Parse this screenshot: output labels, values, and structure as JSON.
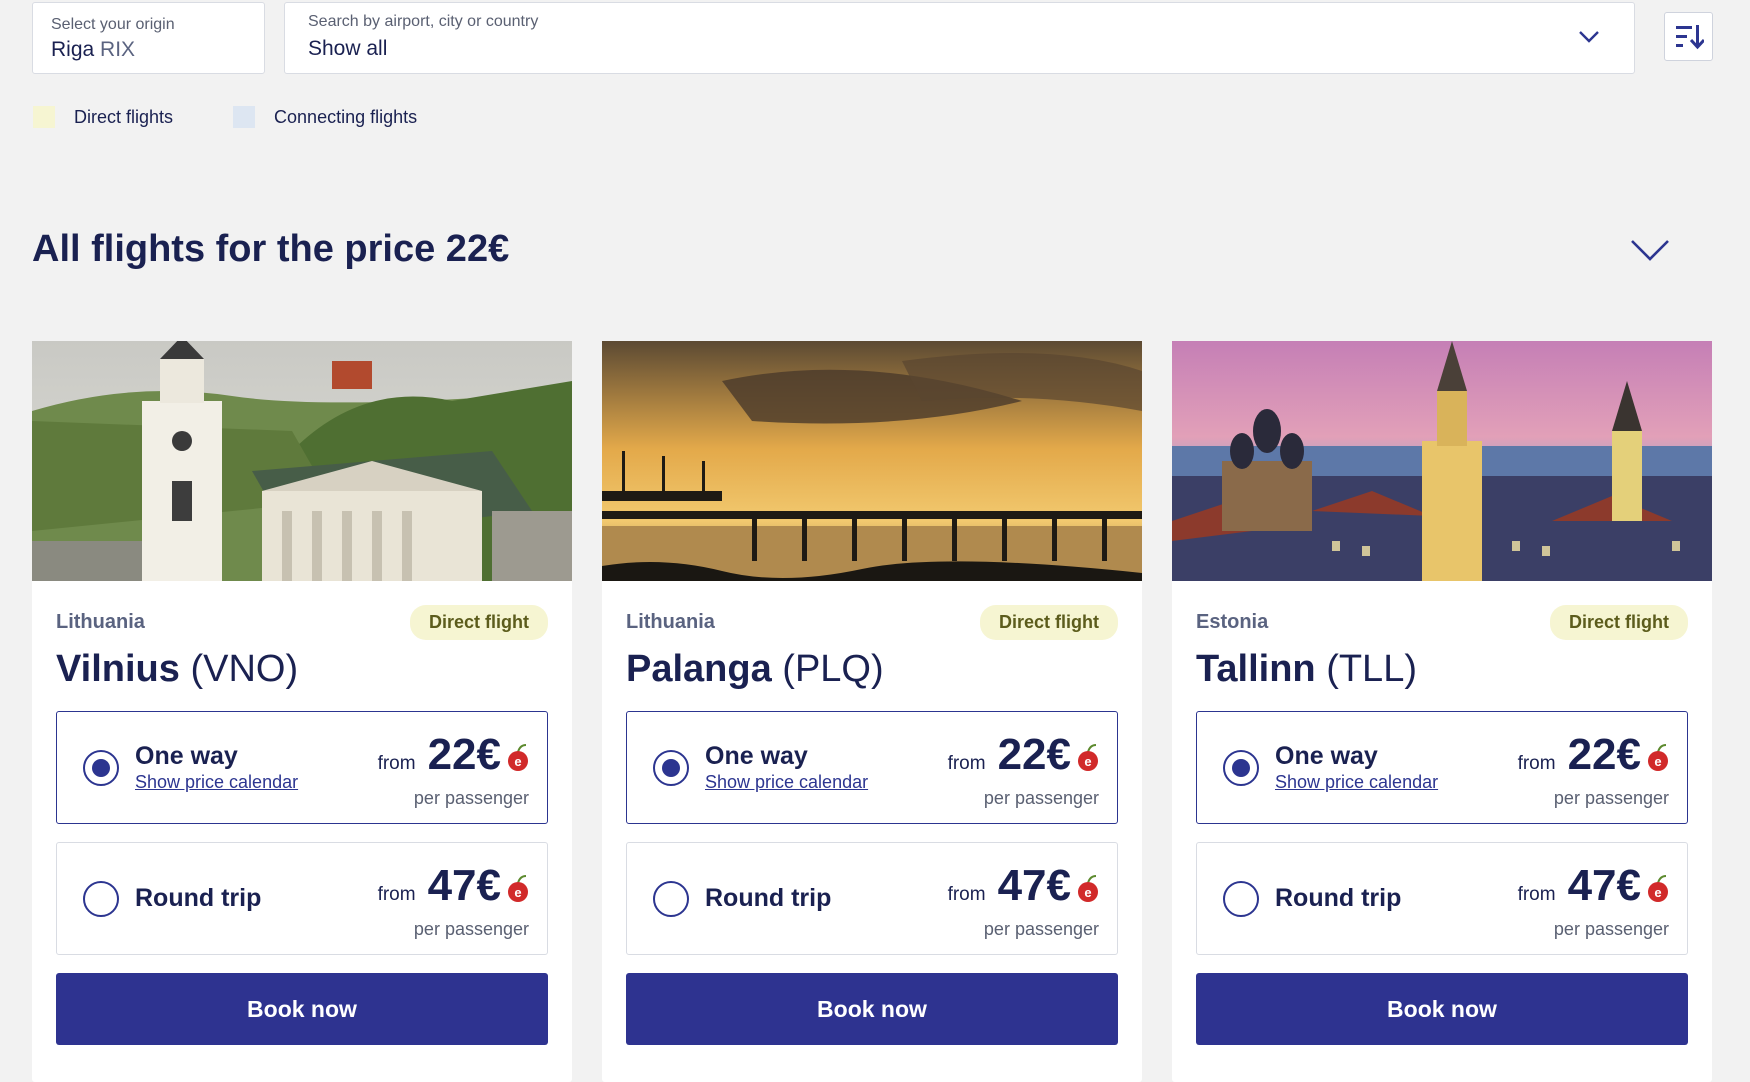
{
  "search": {
    "origin_caption": "Select your origin",
    "origin_city": "Riga",
    "origin_code": "RIX",
    "dest_caption": "Search by airport, city or country",
    "dest_value": "Show all"
  },
  "legend": {
    "direct": {
      "label": "Direct flights",
      "color": "#f6f5d2"
    },
    "connecting": {
      "label": "Connecting flights",
      "color": "#dde6f2"
    }
  },
  "section": {
    "title": "All flights for the price 22€"
  },
  "colors": {
    "primary": "#2e3390",
    "text": "#1a2151",
    "badge_bg": "#f6f5d2"
  },
  "cards": [
    {
      "country": "Lithuania",
      "city": "Vilnius",
      "code": "(VNO)",
      "badge": "Direct flight",
      "one_way": {
        "label": "One way",
        "link": "Show price calendar",
        "from": "from",
        "price": "22€",
        "per": "per passenger"
      },
      "round_trip": {
        "label": "Round trip",
        "from": "from",
        "price": "47€",
        "per": "per passenger"
      },
      "book": "Book now"
    },
    {
      "country": "Lithuania",
      "city": "Palanga",
      "code": "(PLQ)",
      "badge": "Direct flight",
      "one_way": {
        "label": "One way",
        "link": "Show price calendar",
        "from": "from",
        "price": "22€",
        "per": "per passenger"
      },
      "round_trip": {
        "label": "Round trip",
        "from": "from",
        "price": "47€",
        "per": "per passenger"
      },
      "book": "Book now"
    },
    {
      "country": "Estonia",
      "city": "Tallinn",
      "code": "(TLL)",
      "badge": "Direct flight",
      "one_way": {
        "label": "One way",
        "link": "Show price calendar",
        "from": "from",
        "price": "22€",
        "per": "per passenger"
      },
      "round_trip": {
        "label": "Round trip",
        "from": "from",
        "price": "47€",
        "per": "per passenger"
      },
      "book": "Book now"
    }
  ]
}
